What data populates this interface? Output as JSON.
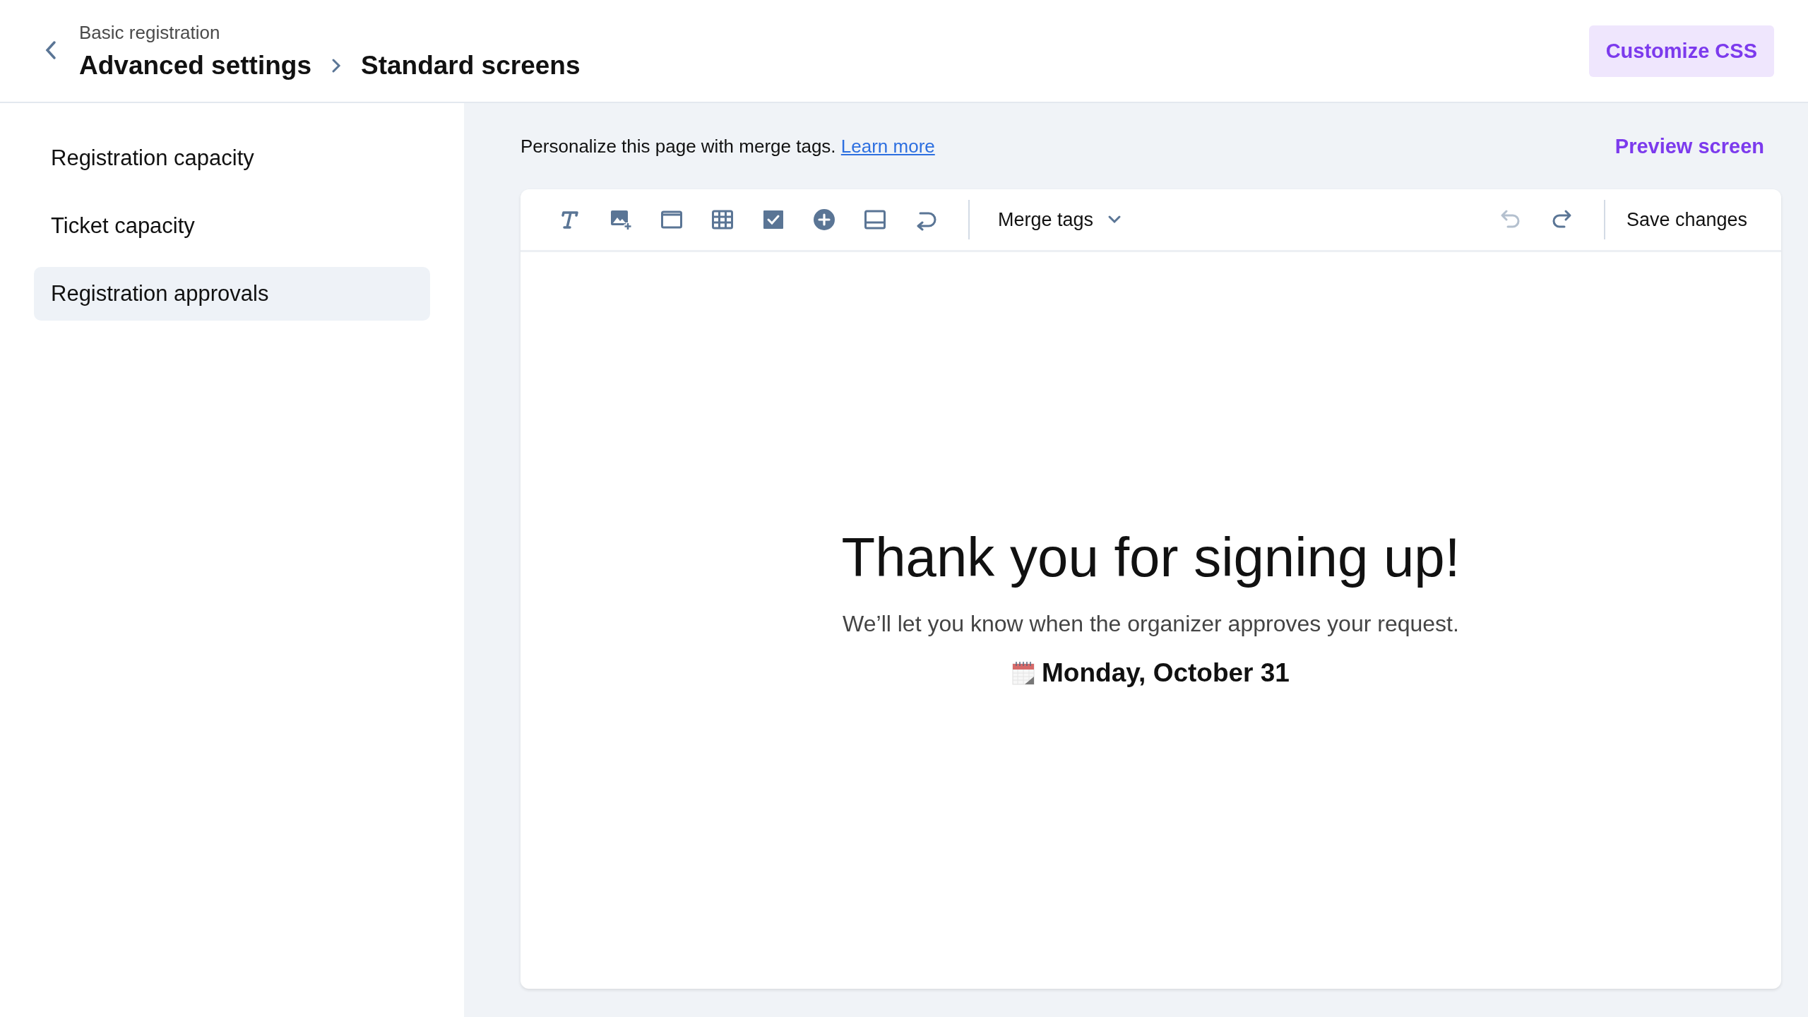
{
  "header": {
    "parent": "Basic registration",
    "breadcrumbs": [
      "Advanced settings",
      "Standard screens"
    ],
    "action": "Customize CSS"
  },
  "sidebar": {
    "items": [
      {
        "label": "Registration capacity",
        "selected": false
      },
      {
        "label": "Ticket capacity",
        "selected": false
      },
      {
        "label": "Registration approvals",
        "selected": true
      }
    ]
  },
  "intro": {
    "text": "Personalize this page with merge tags.",
    "link": "Learn more"
  },
  "preview_link": "Preview screen",
  "toolbar": {
    "tools": [
      {
        "kind": "text"
      },
      {
        "kind": "image"
      },
      {
        "kind": "frame"
      },
      {
        "kind": "table"
      },
      {
        "kind": "checkbox"
      },
      {
        "kind": "add"
      },
      {
        "kind": "footer"
      },
      {
        "kind": "return"
      }
    ],
    "merge_tags": "Merge tags",
    "undo": {
      "disabled": true
    },
    "redo": {
      "disabled": false
    },
    "save": "Save changes"
  },
  "canvas": {
    "heading": "Thank you for signing up!",
    "message": "We’ll let you know when the organizer approves your request.",
    "date": "Monday, October 31"
  }
}
